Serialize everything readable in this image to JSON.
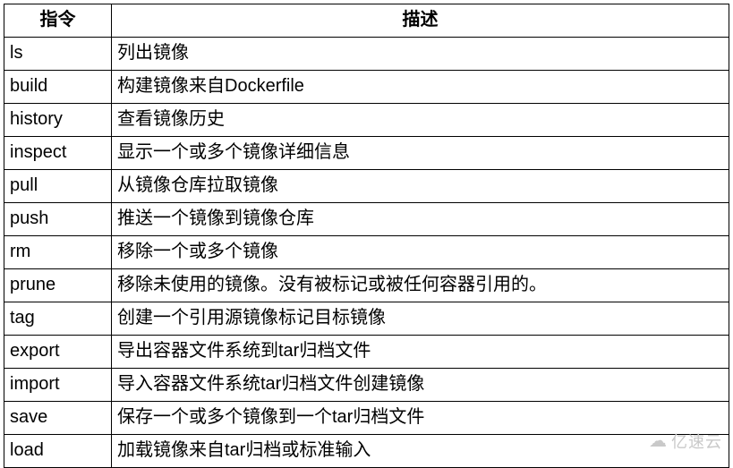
{
  "table": {
    "headers": {
      "command": "指令",
      "description": "描述"
    },
    "rows": [
      {
        "cmd": "ls",
        "desc": "列出镜像"
      },
      {
        "cmd": "build",
        "desc": "构建镜像来自Dockerfile"
      },
      {
        "cmd": "history",
        "desc": "查看镜像历史"
      },
      {
        "cmd": "inspect",
        "desc": "显示一个或多个镜像详细信息"
      },
      {
        "cmd": "pull",
        "desc": "从镜像仓库拉取镜像"
      },
      {
        "cmd": "push",
        "desc": "推送一个镜像到镜像仓库"
      },
      {
        "cmd": "rm",
        "desc": "移除一个或多个镜像"
      },
      {
        "cmd": "prune",
        "desc": "移除未使用的镜像。没有被标记或被任何容器引用的。"
      },
      {
        "cmd": "tag",
        "desc": "创建一个引用源镜像标记目标镜像"
      },
      {
        "cmd": "export",
        "desc": "导出容器文件系统到tar归档文件"
      },
      {
        "cmd": "import",
        "desc": "导入容器文件系统tar归档文件创建镜像"
      },
      {
        "cmd": "save",
        "desc": "保存一个或多个镜像到一个tar归档文件"
      },
      {
        "cmd": "load",
        "desc": "加载镜像来自tar归档或标准输入"
      }
    ]
  },
  "watermark": {
    "text": "亿速云"
  }
}
